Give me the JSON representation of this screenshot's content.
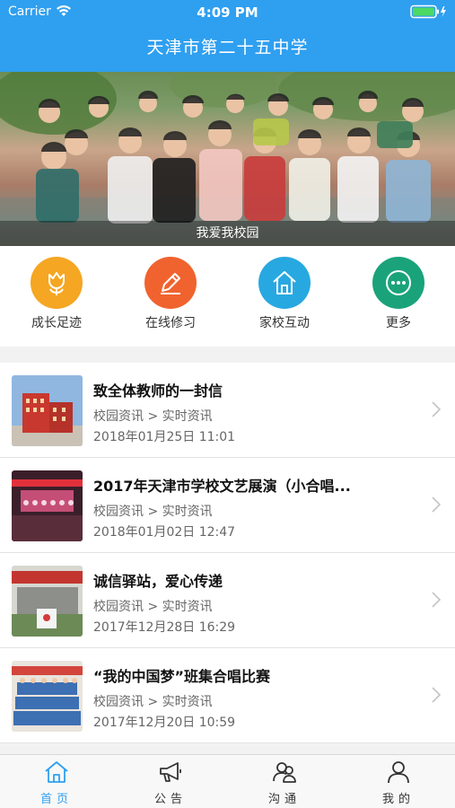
{
  "status_bar": {
    "carrier": "Carrier",
    "time": "4:09 PM"
  },
  "header": {
    "title": "天津市第二十五中学"
  },
  "banner": {
    "caption": "我爱我校园"
  },
  "quick_links": [
    {
      "label": "成长足迹",
      "icon": "tulip-icon",
      "color": "#f5a623"
    },
    {
      "label": "在线修习",
      "icon": "pencil-icon",
      "color": "#f0632f"
    },
    {
      "label": "家校互动",
      "icon": "home-icon",
      "color": "#28a8e0"
    },
    {
      "label": "更多",
      "icon": "more-icon",
      "color": "#1aa37a"
    }
  ],
  "news": [
    {
      "title": "致全体教师的一封信",
      "category": "校园资讯 > 实时资讯",
      "date": "2018年01月25日 11:01"
    },
    {
      "title": "2017年天津市学校文艺展演（小合唱...",
      "category": "校园资讯 > 实时资讯",
      "date": "2018年01月02日 12:47"
    },
    {
      "title": "诚信驿站，爱心传递",
      "category": "校园资讯 > 实时资讯",
      "date": "2017年12月28日 16:29"
    },
    {
      "title": "“我的中国梦”班集合唱比赛",
      "category": "校园资讯 > 实时资讯",
      "date": "2017年12月20日 10:59"
    }
  ],
  "tabs": [
    {
      "label": "首页",
      "icon": "home-icon",
      "active": true
    },
    {
      "label": "公告",
      "icon": "megaphone-icon",
      "active": false
    },
    {
      "label": "沟通",
      "icon": "chat-people-icon",
      "active": false
    },
    {
      "label": "我的",
      "icon": "user-icon",
      "active": false
    }
  ],
  "colors": {
    "primary": "#2f9ff0",
    "battery": "#4cd964"
  }
}
